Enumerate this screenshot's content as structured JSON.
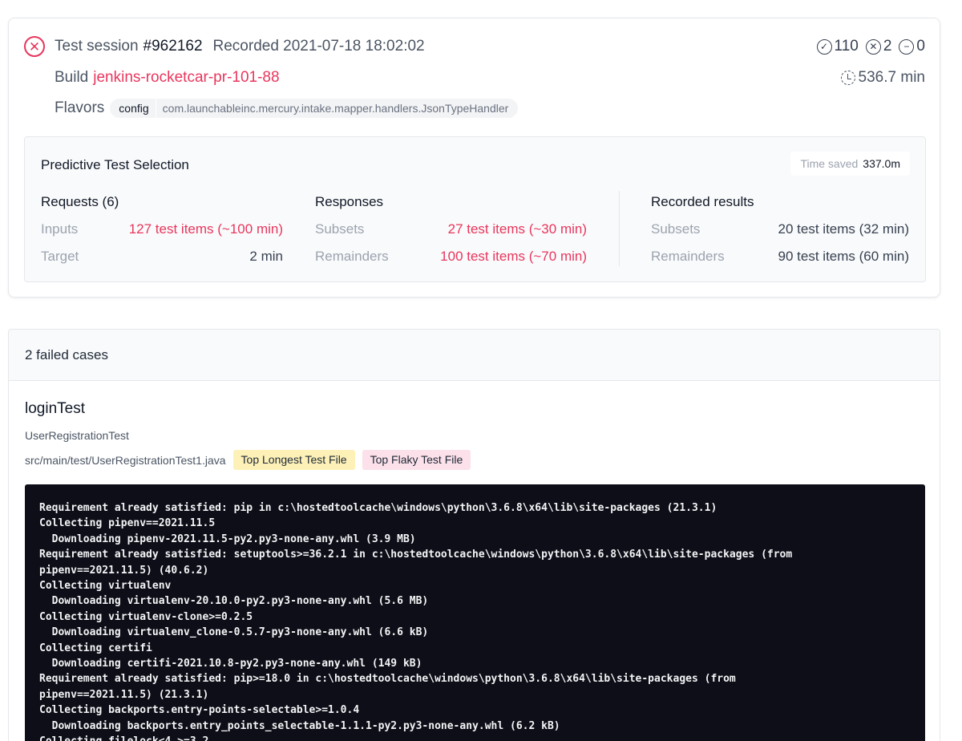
{
  "session": {
    "label": "Test session",
    "id": "#962162",
    "recorded": "Recorded 2021-07-18 18:02:02",
    "status_icon": "failed-circle-x-icon",
    "build_label": "Build",
    "build_name": "jenkins-rocketcar-pr-101-88",
    "flavors_label": "Flavors",
    "flavor_key": "config",
    "flavor_value": "com.launchableinc.mercury.intake.mapper.handlers.JsonTypeHandler",
    "counts": {
      "passed": "110",
      "failed": "2",
      "skipped": "0"
    },
    "duration": "536.7 min"
  },
  "pts": {
    "title": "Predictive Test Selection",
    "time_saved_label": "Time saved",
    "time_saved_value": "337.0m",
    "requests": {
      "heading": "Requests (6)",
      "rows": [
        {
          "label": "Inputs",
          "value": "127 test items (~100 min)"
        },
        {
          "label": "Target",
          "value": "2 min"
        }
      ]
    },
    "responses": {
      "heading": "Responses",
      "rows": [
        {
          "label": "Subsets",
          "value": "27 test items (~30 min)"
        },
        {
          "label": "Remainders",
          "value": "100 test items (~70 min)"
        }
      ]
    },
    "recorded": {
      "heading": "Recorded results",
      "rows": [
        {
          "label": "Subsets",
          "value": "20 test items (32 min)"
        },
        {
          "label": "Remainders",
          "value": "90 test items (60 min)"
        }
      ]
    }
  },
  "failed": {
    "header": "2 failed cases",
    "case": {
      "name": "loginTest",
      "class": "UserRegistrationTest",
      "path": "src/main/test/UserRegistrationTest1.java",
      "badges": [
        "Top Longest Test File",
        "Top Flaky Test File"
      ]
    },
    "log": [
      "Requirement already satisfied: pip in c:\\hostedtoolcache\\windows\\python\\3.6.8\\x64\\lib\\site-packages (21.3.1)",
      "Collecting pipenv==2021.11.5",
      "  Downloading pipenv-2021.11.5-py2.py3-none-any.whl (3.9 MB)",
      "Requirement already satisfied: setuptools>=36.2.1 in c:\\hostedtoolcache\\windows\\python\\3.6.8\\x64\\lib\\site-packages (from",
      "pipenv==2021.11.5) (40.6.2)",
      "Collecting virtualenv",
      "  Downloading virtualenv-20.10.0-py2.py3-none-any.whl (5.6 MB)",
      "Collecting virtualenv-clone>=0.2.5",
      "  Downloading virtualenv_clone-0.5.7-py3-none-any.whl (6.6 kB)",
      "Collecting certifi",
      "  Downloading certifi-2021.10.8-py2.py3-none-any.whl (149 kB)",
      "Requirement already satisfied: pip>=18.0 in c:\\hostedtoolcache\\windows\\python\\3.6.8\\x64\\lib\\site-packages (from",
      "pipenv==2021.11.5) (21.3.1)",
      "Collecting backports.entry-points-selectable>=1.0.4",
      "  Downloading backports.entry_points_selectable-1.1.1-py2.py3-none-any.whl (6.2 kB)",
      "Collecting filelock<4,>=3.2"
    ]
  }
}
